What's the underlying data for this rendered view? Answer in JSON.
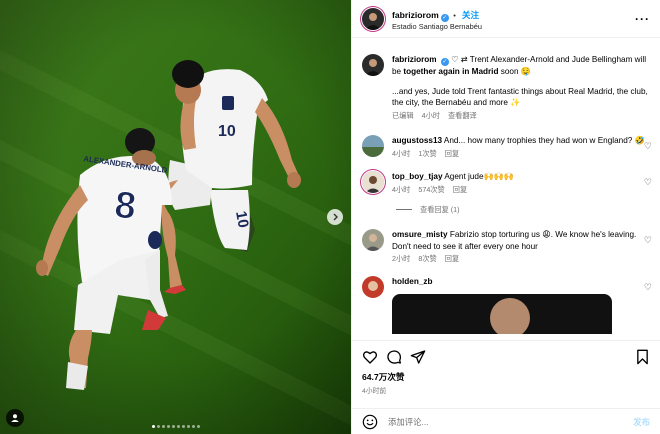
{
  "post": {
    "author": "fabriziorom",
    "follow_label": "关注",
    "location": "Estadio Santiago Bernabéu"
  },
  "caption": {
    "author": "fabriziorom",
    "line1_emoji": "♡ ⇄",
    "line1_pre": " Trent Alexander-Arnold and Jude Bellingham will be ",
    "line1_bold": "together again in Madrid",
    "line1_post": " soon 🤤",
    "line2": "...and yes, Jude told Trent fantastic things about Real Madrid, the club, the city, the Bernabéu and more ✨",
    "meta_edited": "已编辑",
    "meta_time": "4小时",
    "meta_translate": "查看翻译"
  },
  "comments": [
    {
      "user": "augustoss13",
      "text": "And... how many trophies they had won w England? 🤣",
      "time": "4小时",
      "likes": "1次赞",
      "reply": "回复"
    },
    {
      "user": "top_boy_tjay",
      "text": "Agent jude🙌🙌🙌",
      "time": "4小时",
      "likes": "574次赞",
      "reply": "回复"
    },
    {
      "user": "omsure_misty",
      "text": "Fabrizio stop torturing us 😩. We know he's leaving. Don't need to see it after every one hour",
      "time": "2小时",
      "likes": "8次赞",
      "reply": "回复"
    },
    {
      "user": "holden_zb"
    }
  ],
  "view_replies": "查看回复 (1)",
  "stats": {
    "likes": "64.7万次赞",
    "time": "4小时前"
  },
  "composer": {
    "placeholder": "添加评论...",
    "post_label": "发布"
  },
  "photo": {
    "jersey_left_name": "ALEXANDER-ARNOLD",
    "jersey_left_number": "8",
    "jersey_right_number": "10",
    "shorts_right_number": "10",
    "carousel_total": 10,
    "carousel_active": 1
  }
}
